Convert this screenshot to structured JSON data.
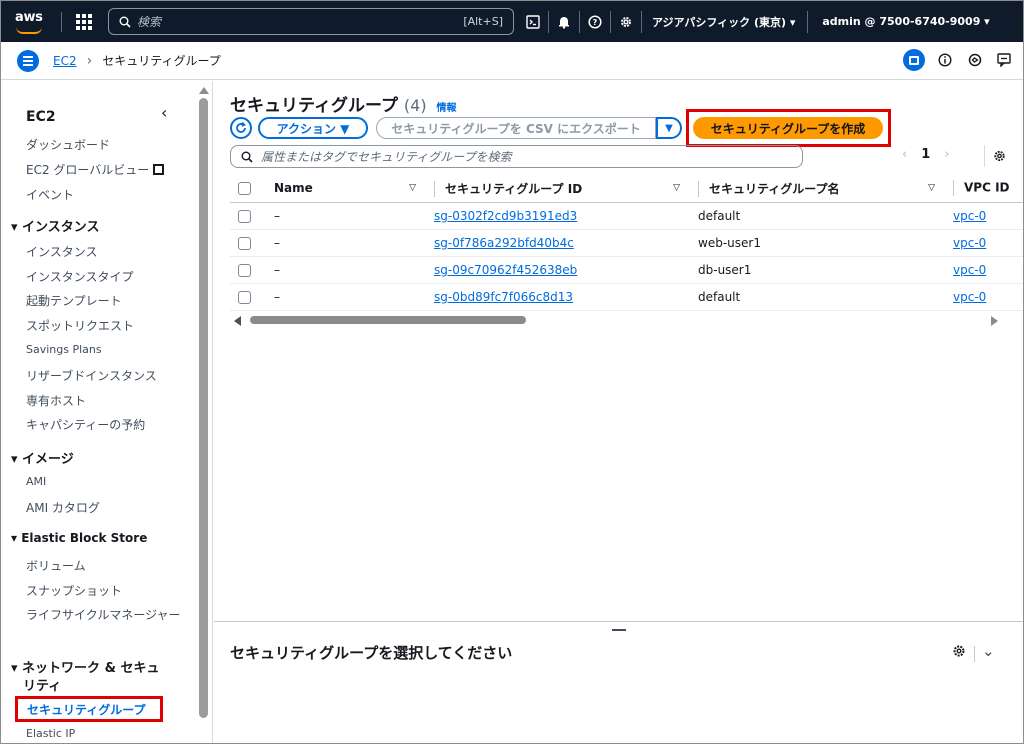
{
  "topbar": {
    "logo_text": "aws",
    "search_placeholder": "検索",
    "search_shortcut": "[Alt+S]",
    "region": "アジアパシフィック (東京) ▾",
    "account": "admin @ 7500-6740-9009 ▾"
  },
  "breadcrumb": {
    "root": "EC2",
    "separator": "›",
    "current": "セキュリティグループ"
  },
  "sidebar": {
    "title": "EC2",
    "items_top": [
      "ダッシュボード",
      "EC2 グローバルビュー",
      "イベント"
    ],
    "section_instances": "▾ インスタンス",
    "instances": [
      "インスタンス",
      "インスタンスタイプ",
      "起動テンプレート",
      "スポットリクエスト",
      "Savings Plans",
      "リザーブドインスタンス",
      "専有ホスト",
      "キャパシティーの予約"
    ],
    "section_images": "▾ イメージ",
    "images": [
      "AMI",
      "AMI カタログ"
    ],
    "section_ebs": "▾ Elastic Block Store",
    "ebs": [
      "ボリューム",
      "スナップショット",
      "ライフサイクルマネージャー"
    ],
    "section_network_1": "▾ ネットワーク & セキュ",
    "section_network_2": "リティ",
    "network_active": "セキュリティグループ",
    "network_next": "Elastic IP"
  },
  "main": {
    "title": "セキュリティグループ",
    "count": "(4)",
    "info": "情報",
    "actions_label": "アクション ▼",
    "export_label": "セキュリティグループを CSV にエクスポート",
    "create_label": "セキュリティグループを作成",
    "filter_placeholder": "属性またはタグでセキュリティグループを検索",
    "page": "1",
    "columns": {
      "name": "Name",
      "id": "セキュリティグループ ID",
      "group_name": "セキュリティグループ名",
      "vpc": "VPC ID"
    },
    "rows": [
      {
        "name": "–",
        "id": "sg-0302f2cd9b3191ed3",
        "group_name": "default",
        "vpc": "vpc-0"
      },
      {
        "name": "–",
        "id": "sg-0f786a292bfd40b4c",
        "group_name": "web-user1",
        "vpc": "vpc-0"
      },
      {
        "name": "–",
        "id": "sg-09c70962f452638eb",
        "group_name": "db-user1",
        "vpc": "vpc-0"
      },
      {
        "name": "–",
        "id": "sg-0bd89fc7f066c8d13",
        "group_name": "default",
        "vpc": "vpc-0"
      }
    ],
    "split_title": "セキュリティグループを選択してください"
  },
  "colors": {
    "topbar_bg": "#0f1b2a",
    "link": "#006ce0",
    "primary_button": "#ff9900",
    "highlight_box": "#e00000"
  }
}
